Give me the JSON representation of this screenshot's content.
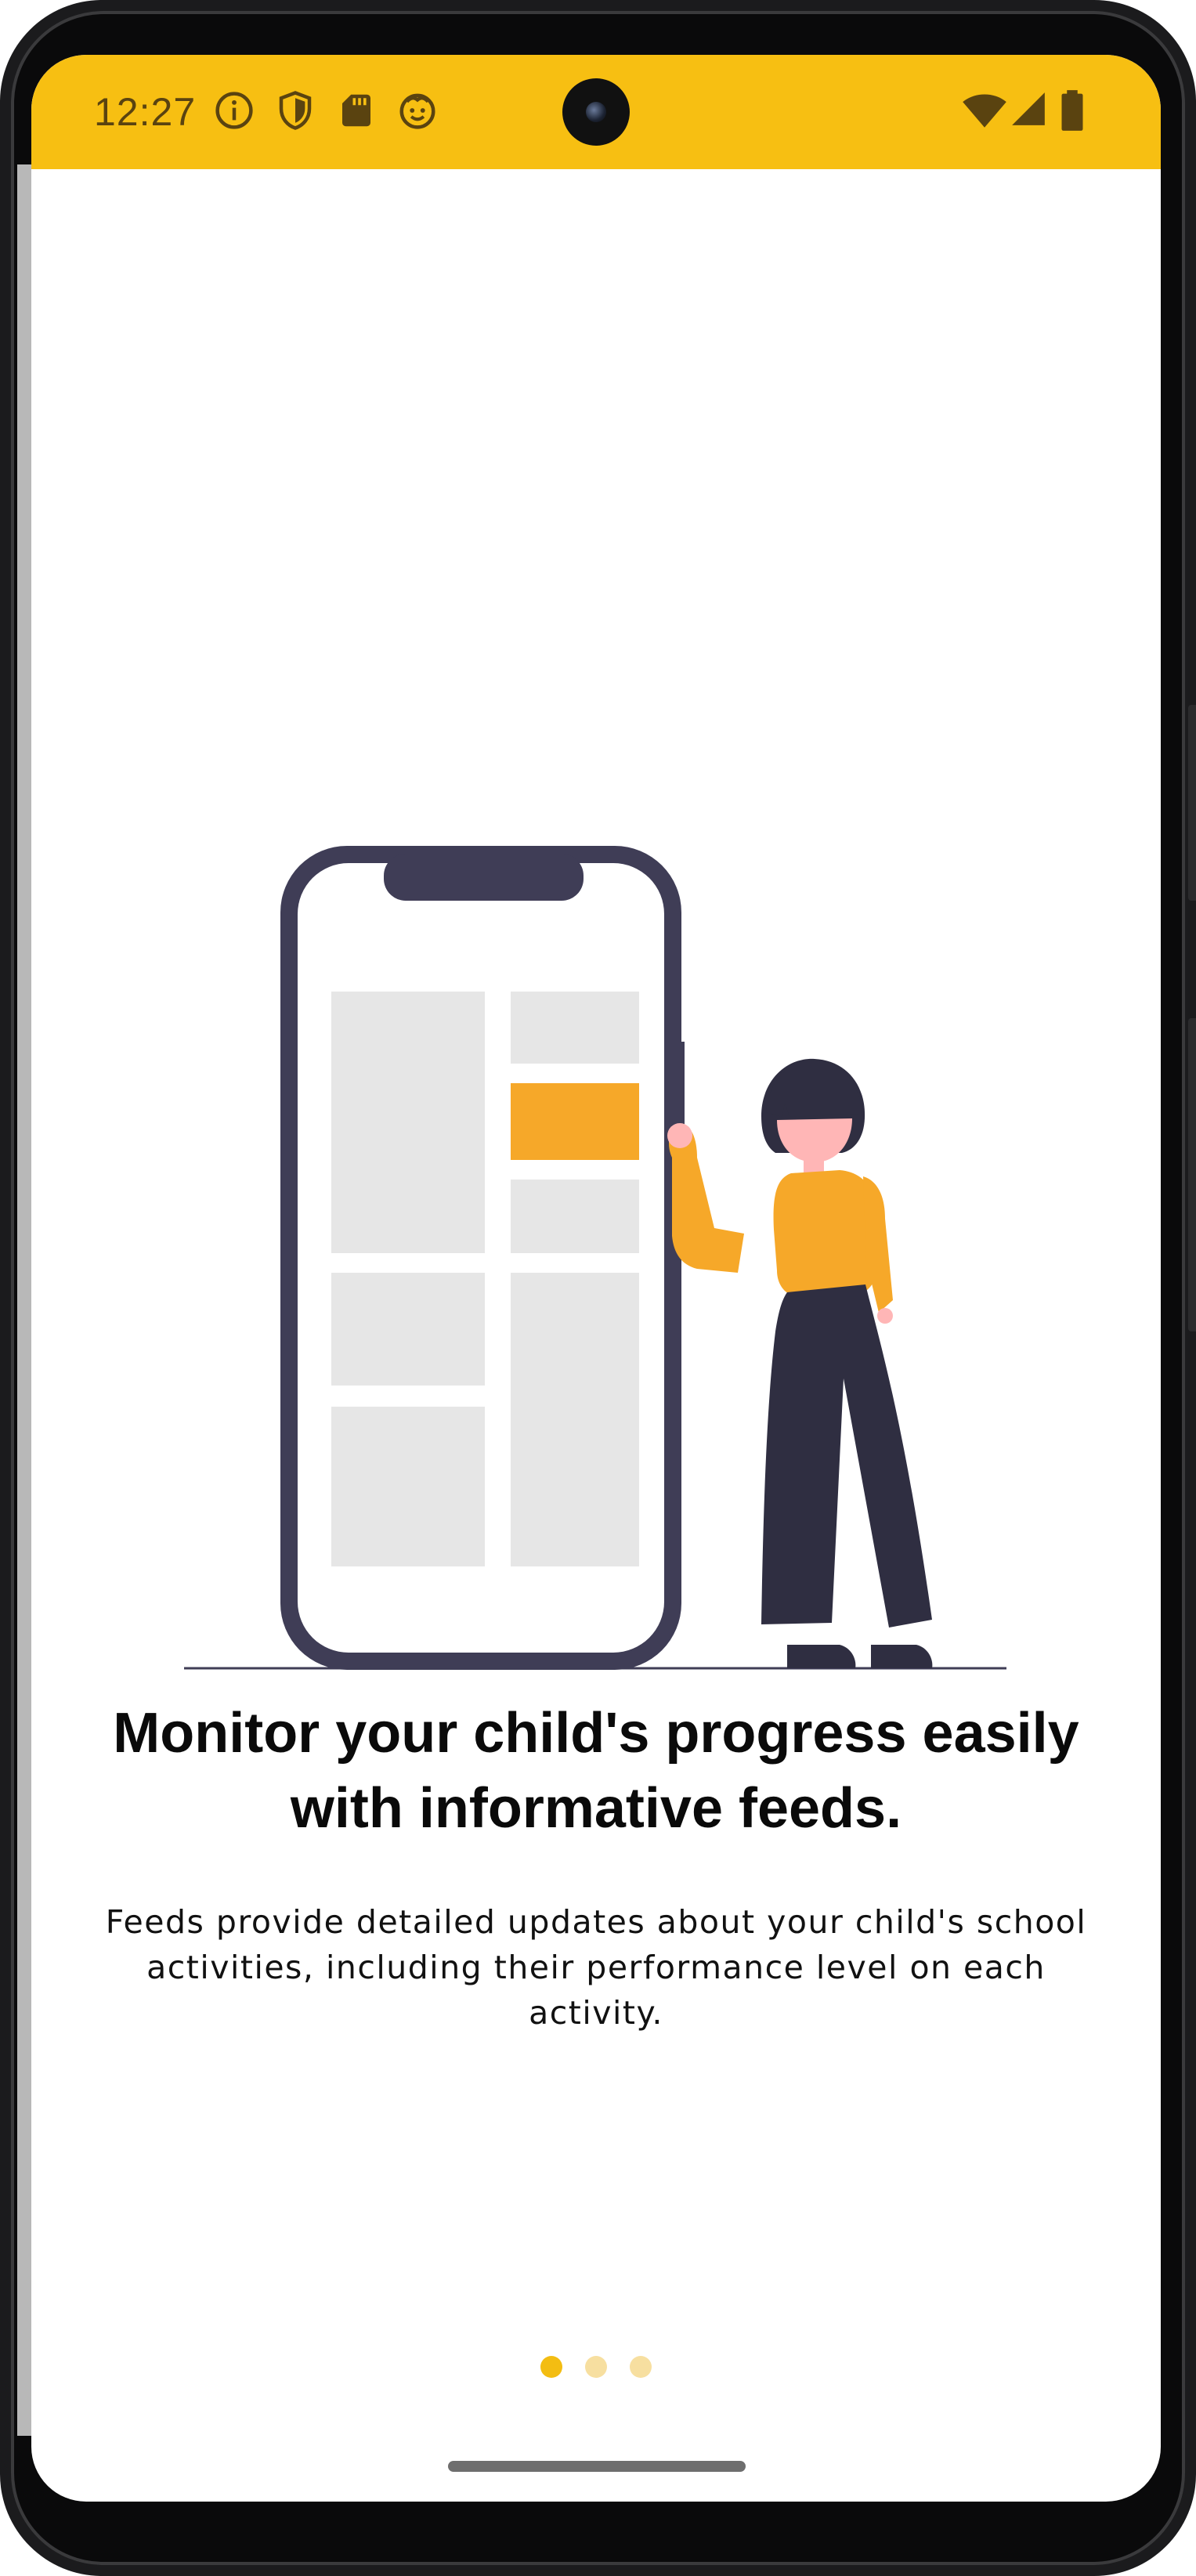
{
  "status_bar": {
    "time": "12:27",
    "left_icons": [
      "info-icon",
      "shield-icon",
      "sd-card-icon",
      "smiley-icon"
    ],
    "right_icons": [
      "wifi-icon",
      "cell-signal-icon",
      "battery-icon"
    ]
  },
  "onboarding": {
    "title": "Monitor your child's progress easily with informative feeds.",
    "description": "Feeds provide detailed updates about your child's school activities, including their performance level on each activity.",
    "illustration": "person-with-phone-illustration"
  },
  "pager": {
    "total_pages": 3,
    "current_page": 1
  },
  "colors": {
    "status_bar": "#f7bf12",
    "accent": "#f6a829",
    "dot_active": "#f3bd12",
    "dot_inactive": "#f7dfa0",
    "phone_frame": "#3f3d56",
    "placeholder": "#e6e6e6"
  }
}
